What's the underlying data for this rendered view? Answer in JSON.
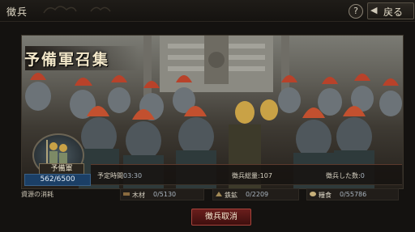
{
  "topbar": {
    "title": "徴兵",
    "help_label": "?",
    "back_label": "戻る"
  },
  "banner": {
    "title": "予備軍召集"
  },
  "unit": {
    "name": "予備軍",
    "count": "562/6500"
  },
  "info": {
    "time_label": "予定時間",
    "time_value": "03:30",
    "total_label": "徴兵総量:",
    "total_value": "107",
    "done_label": "徴兵した数:",
    "done_value": "0"
  },
  "resources": {
    "label": "資源の消耗",
    "items": [
      {
        "icon": "wood-icon",
        "name": "木材",
        "value": "0/5130"
      },
      {
        "icon": "iron-icon",
        "name": "鉄鉱",
        "value": "0/2209"
      },
      {
        "icon": "grain-icon",
        "name": "糧食",
        "value": "0/55786"
      }
    ]
  },
  "actions": {
    "cancel_label": "徴兵取消"
  },
  "colors": {
    "accent_red": "#6a1e1c",
    "count_blue": "#1b3f66",
    "plume_red": "#b8422a"
  }
}
